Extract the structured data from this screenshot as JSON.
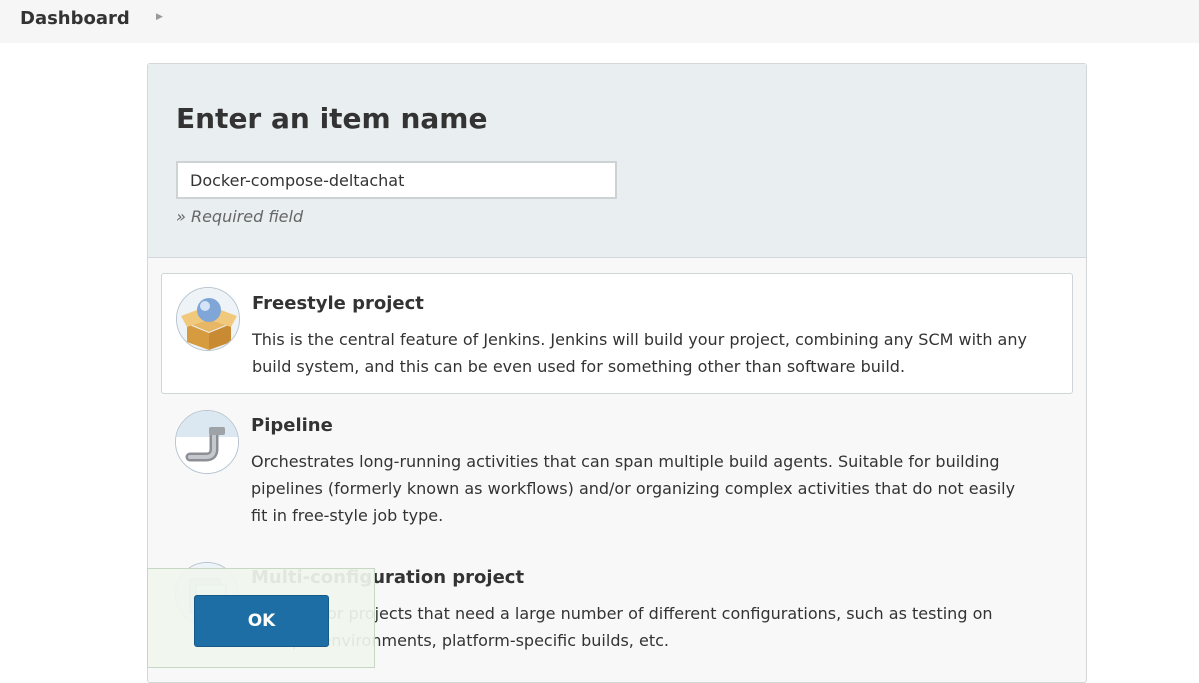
{
  "breadcrumb": {
    "dashboard": "Dashboard"
  },
  "form": {
    "title": "Enter an item name",
    "item_name_value": "Docker-compose-deltachat",
    "required_hint": "» Required field"
  },
  "item_types": [
    {
      "name": "Freestyle project",
      "description_lines": [
        "This is the central feature of Jenkins. Jenkins will build your project, combining any SCM with any",
        "build system, and this can be even used for something other than software build."
      ],
      "icon": "freestyle-package-icon",
      "selected": true
    },
    {
      "name": "Pipeline",
      "description_lines": [
        "Orchestrates long-running activities that can span multiple build agents. Suitable for building",
        "pipelines (formerly known as workflows) and/or organizing complex activities that do not easily",
        "fit in free-style job type."
      ],
      "icon": "pipeline-pipe-icon",
      "selected": false
    },
    {
      "name": "Multi-configuration project",
      "description_lines": [
        "Suitable for projects that need a large number of different configurations, such as testing on",
        "multiple environments, platform-specific builds, etc."
      ],
      "icon": "multi-configuration-icon",
      "selected": false
    }
  ],
  "actions": {
    "ok_label": "OK"
  },
  "colors": {
    "ok_button": "#1c6ea4",
    "header_bg": "#e9eef1"
  }
}
